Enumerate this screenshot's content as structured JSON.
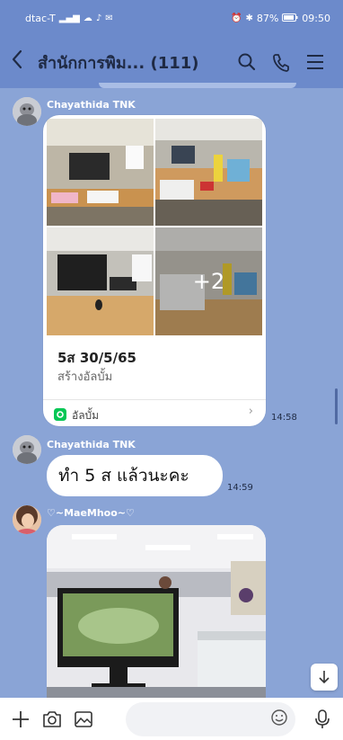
{
  "status_bar": {
    "carrier": "dtac-T",
    "battery": "87%",
    "time": "09:50"
  },
  "header": {
    "title": "สำนักการพิม... (111)",
    "icons": [
      "back-icon",
      "search-icon",
      "phone-icon",
      "menu-icon"
    ]
  },
  "messages": [
    {
      "sender": "Chayathida TNK",
      "type": "album",
      "album_title": "5ส 30/5/65",
      "album_subtitle": "สร้างอัลบั้ม",
      "album_footer_label": "อัลบั้ม",
      "more_photos": "+2",
      "time": "14:58"
    },
    {
      "sender": "Chayathida TNK",
      "type": "text",
      "text": "ทำ 5 ส แล้วนะคะ",
      "time": "14:59"
    },
    {
      "sender": "♡~MaeMhoo~♡",
      "type": "photo"
    }
  ],
  "input_bar": {
    "icons": [
      "plus-icon",
      "camera-icon",
      "image-icon",
      "emoji-icon",
      "microphone-icon"
    ]
  },
  "colors": {
    "chat_background": "#8aa4d6",
    "header_background": "#6c8acb",
    "bubble": "#ffffff",
    "album_icon": "#06c755"
  }
}
